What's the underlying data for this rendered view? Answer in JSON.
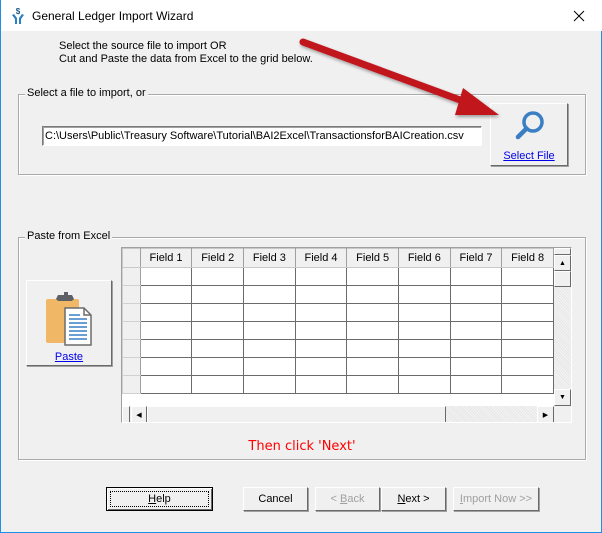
{
  "window": {
    "title": "General Ledger Import Wizard",
    "app_icon": "money-hands-icon",
    "close_icon": "close-icon"
  },
  "instructions": {
    "line1": "Select the source file to import OR",
    "line2": "Cut and Paste the data from Excel to the grid below."
  },
  "file_group": {
    "legend": "Select a file to import, or",
    "file_path": "C:\\Users\\Public\\Treasury Software\\Tutorial\\BAI2Excel\\TransactionsforBAICreation.csv",
    "select_button_label": "Select File",
    "select_button_icon": "magnifier-icon"
  },
  "paste_group": {
    "legend": "Paste from Excel",
    "paste_button_label": "Paste",
    "paste_button_icon": "clipboard-icon",
    "grid": {
      "columns": [
        "Field 1",
        "Field 2",
        "Field 3",
        "Field 4",
        "Field 5",
        "Field 6",
        "Field 7",
        "Field 8"
      ],
      "row_count": 7
    }
  },
  "hint": "Then click 'Next'",
  "buttons": {
    "help": {
      "label_u": "H",
      "label_rest": "elp"
    },
    "cancel": {
      "label": "Cancel"
    },
    "back": {
      "label_pre": "< ",
      "label_u": "B",
      "label_rest": "ack"
    },
    "next": {
      "label_u": "N",
      "label_rest": "ext >"
    },
    "import_now": {
      "label_u": "I",
      "label_rest": "mport Now >>"
    }
  },
  "colors": {
    "hint_color": "#ff0000",
    "link_color": "#0000ee",
    "arrow_color": "#c0121c",
    "window_border": "#1e90e8"
  }
}
